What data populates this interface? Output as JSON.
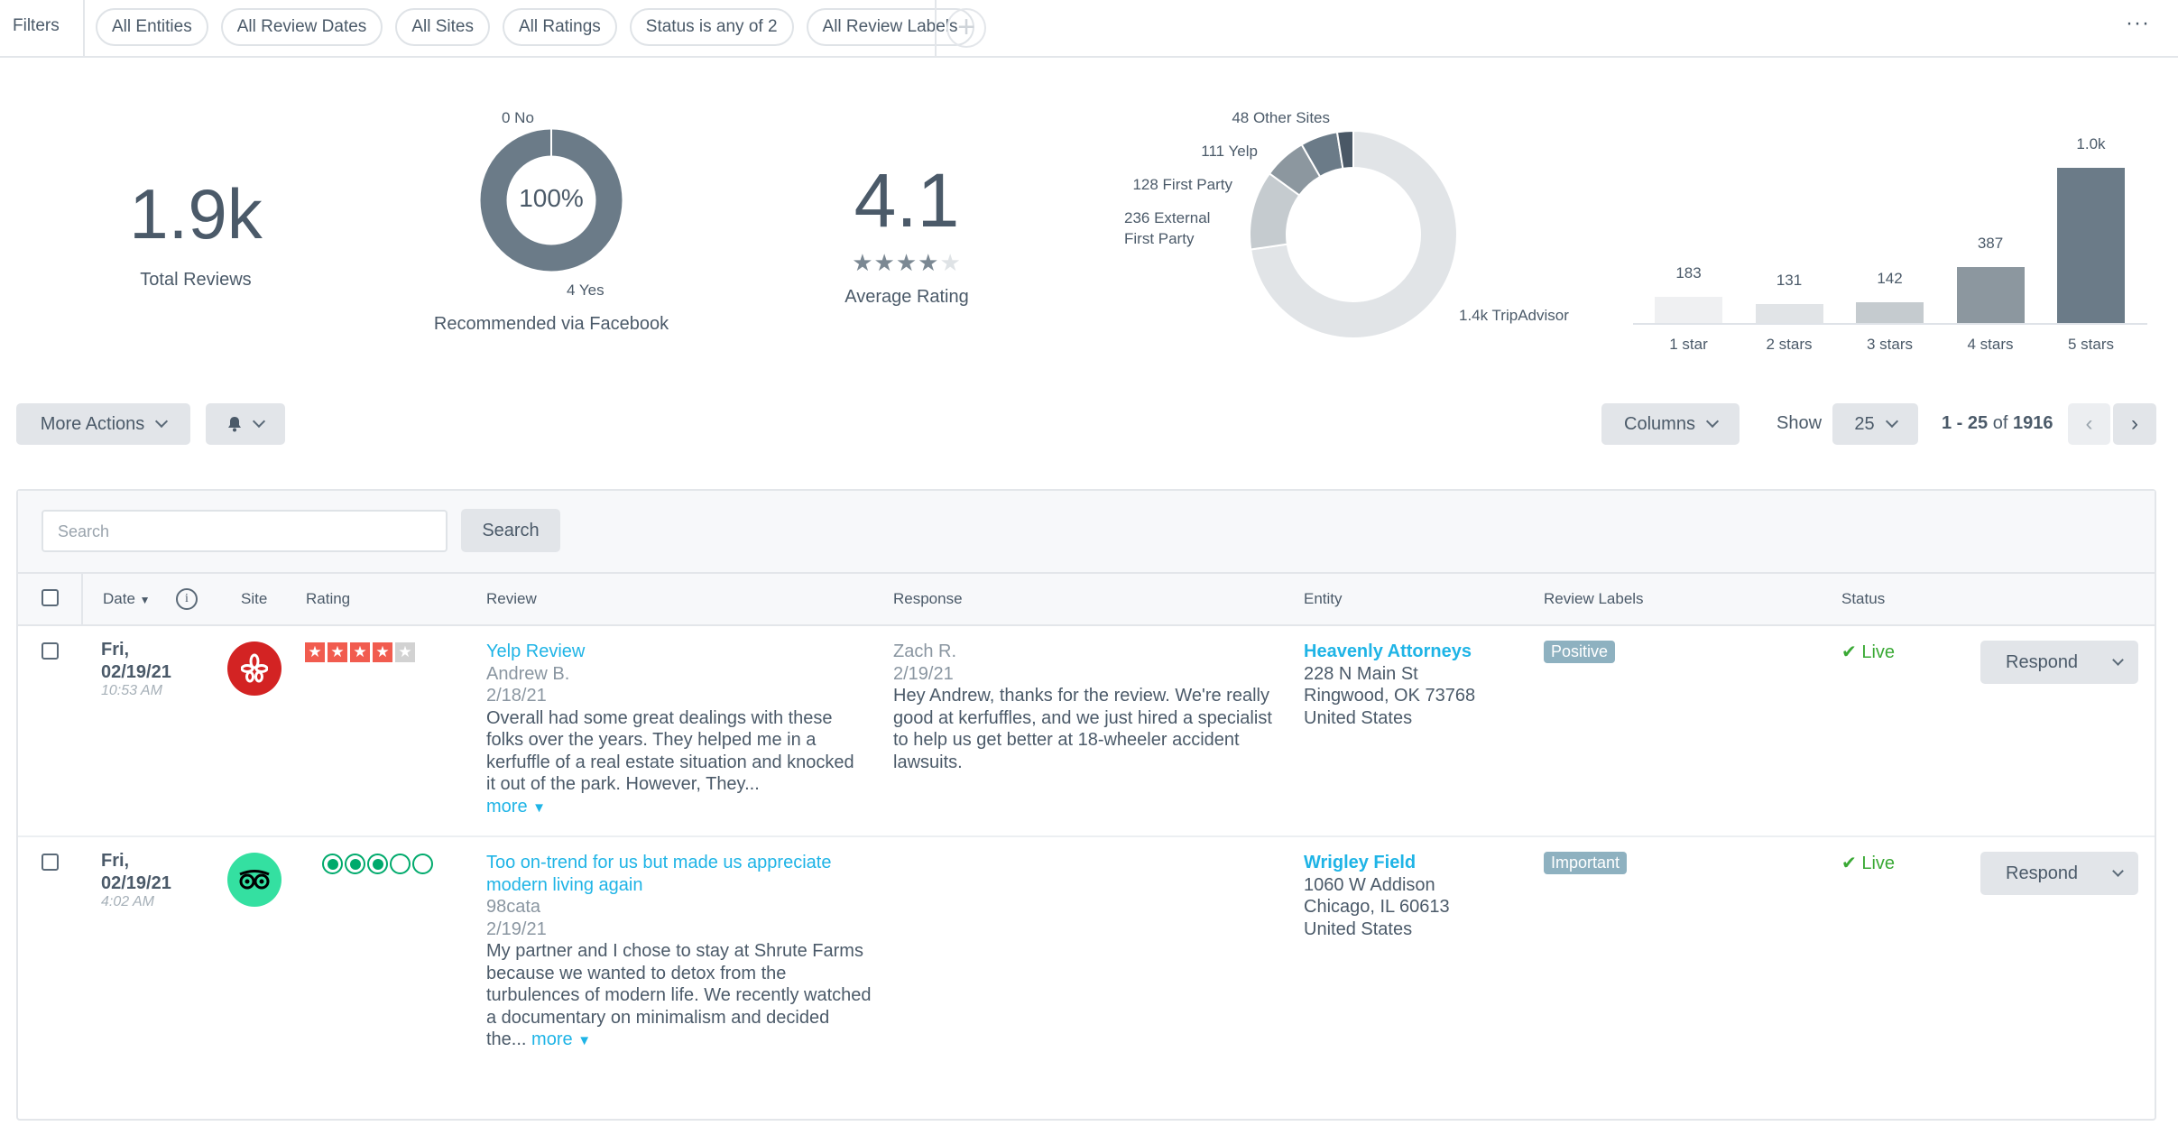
{
  "filters": {
    "label": "Filters",
    "pills": [
      "All Entities",
      "All Review Dates",
      "All Sites",
      "All Ratings",
      "Status is any of 2",
      "All Review Labels"
    ],
    "add_icon": "plus-icon",
    "more_icon": "ellipsis-icon",
    "more_label": "···"
  },
  "summary": {
    "total": {
      "value": "1.9k",
      "label": "Total Reviews"
    },
    "facebook": {
      "center": "100%",
      "no_label": "0 No",
      "yes_label": "4 Yes",
      "no": 0,
      "yes": 4,
      "label": "Recommended via Facebook",
      "color": "#6b7b88"
    },
    "rating": {
      "value": "4.1",
      "stars": 4.1,
      "label": "Average Rating"
    },
    "sites": {
      "slices": [
        {
          "name": "TripAdvisor",
          "label": "1.4k TripAdvisor",
          "value": 1393,
          "color": "#e1e4e7"
        },
        {
          "name": "External First Party",
          "label_lines": [
            "236 External",
            "First Party"
          ],
          "value": 236,
          "color": "#c5cbcf"
        },
        {
          "name": "First Party",
          "label": "128 First Party",
          "value": 128,
          "color": "#8c979f"
        },
        {
          "name": "Yelp",
          "label": "111 Yelp",
          "value": 111,
          "color": "#6b7b88"
        },
        {
          "name": "Other Sites",
          "label": "48 Other Sites",
          "value": 48,
          "color": "#4a5866"
        }
      ]
    },
    "stars": {
      "bars": [
        {
          "category": "1 star",
          "label": "183",
          "value": 183,
          "color": "#eff0f2"
        },
        {
          "category": "2 stars",
          "label": "131",
          "value": 131,
          "color": "#e1e4e7"
        },
        {
          "category": "3 stars",
          "label": "142",
          "value": 142,
          "color": "#c5cbcf"
        },
        {
          "category": "4 stars",
          "label": "387",
          "value": 387,
          "color": "#8c979f"
        },
        {
          "category": "5 stars",
          "label": "1.0k",
          "value": 1073,
          "color": "#6b7b88"
        }
      ]
    }
  },
  "toolbar": {
    "more_actions": "More Actions",
    "bell_icon": "bell-icon",
    "columns": "Columns",
    "show": "Show",
    "page_size": "25",
    "range": "1 - 25",
    "of": "of",
    "total": "1916"
  },
  "table": {
    "search_placeholder": "Search",
    "search_button": "Search",
    "headers": {
      "date": "Date",
      "site": "Site",
      "rating": "Rating",
      "review": "Review",
      "response": "Response",
      "entity": "Entity",
      "labels": "Review Labels",
      "status": "Status"
    },
    "rows": [
      {
        "day": "Fri,",
        "date": "02/19/21",
        "time": "10:53 AM",
        "site": "Yelp",
        "site_color": "#d32323",
        "rating": 4,
        "title": "Yelp Review",
        "author": "Andrew B.",
        "review_date": "2/18/21",
        "text": "Overall had some great dealings with these folks over the years. They helped me in a kerfuffle of a real estate situation and knocked it out of the park. However, They...",
        "more": "more",
        "responder": "Zach R.",
        "response_date": "2/19/21",
        "response": "Hey Andrew, thanks for the review. We're really good at kerfuffles, and we just hired a specialist to help us get better at 18-wheeler accident lawsuits.",
        "entity": "Heavenly Attorneys",
        "address": [
          "228 N Main St",
          "Ringwood, OK 73768",
          "United States"
        ],
        "label": "Positive",
        "status": "Live",
        "action": "Respond"
      },
      {
        "day": "Fri,",
        "date": "02/19/21",
        "time": "4:02 AM",
        "site": "TripAdvisor",
        "site_color": "#34e0a1",
        "rating": 3,
        "title": "Too on-trend for us but made us appreciate modern living again",
        "author": "98cata",
        "review_date": "2/19/21",
        "text": "My partner and I chose to stay at Shrute Farms because we wanted to detox from the turbulences of modern life. We recently watched a documentary on minimalism and decided the...",
        "more": "more",
        "entity": "Wrigley Field",
        "address": [
          "1060 W Addison",
          "Chicago, IL 60613",
          "United States"
        ],
        "label": "Important",
        "status": "Live",
        "action": "Respond"
      }
    ]
  }
}
